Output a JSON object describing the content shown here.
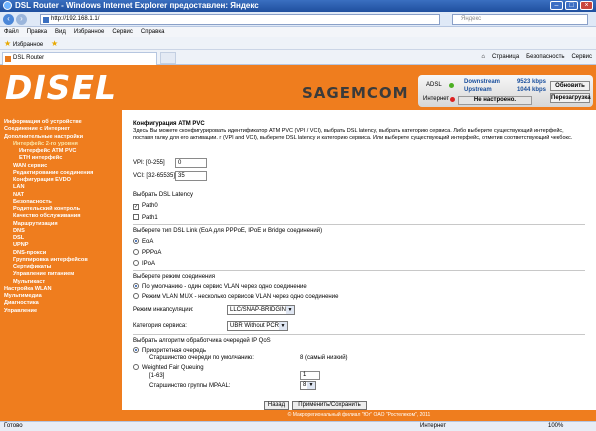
{
  "window": {
    "title": "DSL Router - Windows Internet Explorer предоставлен: Яндекс"
  },
  "address": {
    "url": "http://192.168.1.1/",
    "search_placeholder": "Яндекс"
  },
  "menu": [
    "Файл",
    "Правка",
    "Вид",
    "Избранное",
    "Сервис",
    "Справка"
  ],
  "favorites": {
    "label": "Избранное"
  },
  "tab": {
    "label": "DSL Router"
  },
  "tools": [
    "Страница",
    "Безопасность",
    "Сервис"
  ],
  "header": {
    "logo": "DISEL",
    "brand": "SAGEMCOM",
    "adsl_label": "ADSL",
    "internet_label": "Интернет",
    "downstream_label": "Downstream",
    "downstream_value": "9523 kbps",
    "upstream_label": "Upstream",
    "upstream_value": "1044 kbps",
    "not_configured": "Не настроено.",
    "refresh_label": "Обновить",
    "reboot_label": "Перезагрузка"
  },
  "sidebar": {
    "items": [
      {
        "label": "Информация об устройстве",
        "level": 1
      },
      {
        "label": "Соединение с Интернет",
        "level": 1
      },
      {
        "label": "Дополнительные настройки",
        "level": 1
      },
      {
        "label": "Интерфейс 2-го уровня",
        "level": 2
      },
      {
        "label": "Интерфейс ATM PVC",
        "level": 3
      },
      {
        "label": "ETH интерфейс",
        "level": 3
      },
      {
        "label": "WAN сервис",
        "level": 2
      },
      {
        "label": "Редактирование соединения",
        "level": 2
      },
      {
        "label": "Конфигурация EVDO",
        "level": 2
      },
      {
        "label": "LAN",
        "level": 2
      },
      {
        "label": "NAT",
        "level": 2
      },
      {
        "label": "Безопасность",
        "level": 2
      },
      {
        "label": "Родительский контроль",
        "level": 2
      },
      {
        "label": "Качество обслуживания",
        "level": 2
      },
      {
        "label": "Маршрутизация",
        "level": 2
      },
      {
        "label": "DNS",
        "level": 2
      },
      {
        "label": "DSL",
        "level": 2
      },
      {
        "label": "UPNP",
        "level": 2
      },
      {
        "label": "DNS-прокси",
        "level": 2
      },
      {
        "label": "Группировка интерфейсов",
        "level": 2
      },
      {
        "label": "Сертификаты",
        "level": 2
      },
      {
        "label": "Управление питанием",
        "level": 2
      },
      {
        "label": "Мультикаст",
        "level": 2
      },
      {
        "label": "Настройка WLAN",
        "level": 1
      },
      {
        "label": "Мультимедиа",
        "level": 1
      },
      {
        "label": "Диагностика",
        "level": 1
      },
      {
        "label": "Управление",
        "level": 1
      }
    ]
  },
  "form": {
    "title": "Конфигурация ATM PVC",
    "description": "Здесь Вы можете сконфигурировать идентификатор ATM PVC (VPI / VCI), выбрать DSL latency, выбрать категорию сервиса. Либо выберите существующий интерфейс, поставя галку для его активации. г (VPI and VCI), выберете DSL latency и категорию сервиса. Или выберете существующий интерфейс, отметив соответствующий чекбокс.",
    "vpi_label": "VPI: [0-255]",
    "vpi_value": "0",
    "vci_label": "VCI: [32-65535]",
    "vci_value": "35",
    "latency_label": "Выбрать DSL Latency",
    "path0": "Path0",
    "path1": "Path1",
    "link_label": "Выберете тип DSL Link (EoA для PPPoE, IPoE и Bridge соединений)",
    "link_eoa": "EoA",
    "link_pppoa": "PPPoA",
    "link_ipoa": "IPoA",
    "mode_label": "Выберете режим соединения",
    "mode_default": "По умолчанию - один сервис VLAN через одно соединение",
    "mode_vlanmux": "Режим VLAN MUX - несколько сервисов VLAN через одно соединение",
    "encap_label": "Режим инкапсуляции:",
    "encap_value": "LLC/SNAP-BRIDGING",
    "category_label": "Категория сервиса:",
    "category_value": "UBR Without PCR",
    "qos_label": "Выбрать алгоритм обработчика очередей IP QoS",
    "qos_priority": "Приоритетная очередь",
    "qos_priority_default_label": "Старшинство очереди по умолчанию:",
    "qos_priority_default_value": "8 (самый низкий)",
    "qos_wfq": "Weighted Fair Queuing",
    "wfq_range": "[1-63]",
    "wfq_value": "1",
    "mpaal_label": "Старшинство группы MPAAL:",
    "mpaal_value": "8",
    "back_button": "Назад",
    "apply_button": "Применить/Сохранить"
  },
  "copyright": "© Макрорегиональный филиал \"Юг\" ОАО \"Ростелеком\", 2011",
  "statusbar": {
    "status": "Готово",
    "zone": "Интернет",
    "zoom": "100%"
  }
}
